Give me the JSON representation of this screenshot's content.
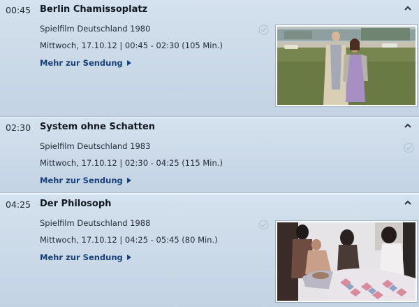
{
  "entries": [
    {
      "time": "00:45",
      "title": "Berlin Chamissoplatz",
      "genre": "Spielfilm Deutschland 1980",
      "schedule": "Mittwoch, 17.10.12 | 00:45 - 02:30 (105 Min.)",
      "more_label": "Mehr zur Sendung",
      "has_image": true
    },
    {
      "time": "02:30",
      "title": "System ohne Schatten",
      "genre": "Spielfilm Deutschland 1983",
      "schedule": "Mittwoch, 17.10.12 | 02:30 - 04:25 (115 Min.)",
      "more_label": "Mehr zur Sendung",
      "has_image": false
    },
    {
      "time": "04:25",
      "title": "Der Philosoph",
      "genre": "Spielfilm Deutschland 1988",
      "schedule": "Mittwoch, 17.10.12 | 04:25 - 05:45 (80 Min.)",
      "more_label": "Mehr zur Sendung",
      "has_image": true
    }
  ],
  "colors": {
    "link": "#173f7a",
    "row_background": "#c9d8e7",
    "separator": "#f4f8fb"
  },
  "icons": {
    "collapse": "chevron-up-icon",
    "remember": "checkmark-circle-icon",
    "link_arrow": "triangle-right-icon"
  }
}
